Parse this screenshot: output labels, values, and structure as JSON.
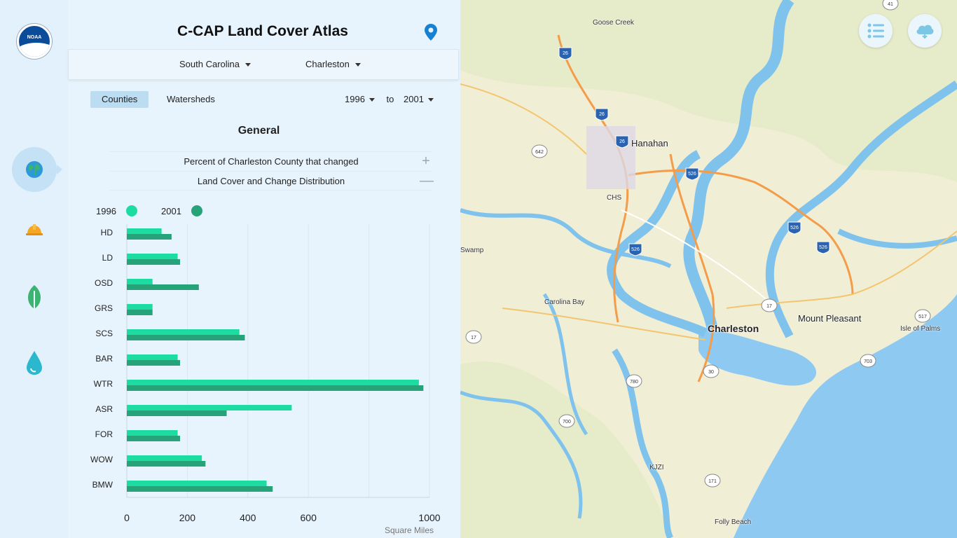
{
  "app": {
    "title": "C-CAP Land Cover Atlas",
    "logo_text": "NOAA"
  },
  "selectors": {
    "state": "South Carolina",
    "county": "Charleston"
  },
  "tabs": [
    {
      "label": "Counties",
      "active": true
    },
    {
      "label": "Watersheds",
      "active": false
    }
  ],
  "years": {
    "from": "1996",
    "to_label": "to",
    "to": "2001"
  },
  "section": {
    "title": "General"
  },
  "accordions": [
    {
      "label": "Percent of Charleston County that changed",
      "state": "+"
    },
    {
      "label": "Land Cover and Change Distribution",
      "state": "—"
    }
  ],
  "legend": [
    {
      "label": "1996",
      "color": "#1ddca2"
    },
    {
      "label": "2001",
      "color": "#27a37a"
    }
  ],
  "chart_data": {
    "type": "bar",
    "orientation": "horizontal",
    "categories": [
      "HD",
      "LD",
      "OSD",
      "GRS",
      "SCS",
      "BAR",
      "WTR",
      "ASR",
      "FOR",
      "WOW",
      "BMW"
    ],
    "series": [
      {
        "name": "1996",
        "color": "#1ddca2",
        "values": [
          115,
          168,
          85,
          85,
          372,
          168,
          965,
          545,
          168,
          248,
          462
        ]
      },
      {
        "name": "2001",
        "color": "#27a37a",
        "values": [
          148,
          176,
          238,
          85,
          390,
          176,
          980,
          330,
          176,
          260,
          482
        ]
      }
    ],
    "xlabel": "Square Miles",
    "xlim": [
      0,
      1000
    ],
    "xticks": [
      0,
      200,
      400,
      600,
      1000
    ],
    "grid": true
  },
  "sidebar_icons": [
    "globe-icon",
    "hard-hat-icon",
    "leaf-icon",
    "water-drop-icon"
  ],
  "map": {
    "buttons": [
      "list-icon",
      "cloud-icon"
    ],
    "labels": {
      "goose_creek": "Goose Creek",
      "hanahan": "Hanahan",
      "chs": "CHS",
      "swamp": "Swamp",
      "carolina_bay": "Carolina Bay",
      "charleston": "Charleston",
      "mount_pleasant": "Mount Pleasant",
      "isle_of_palms": "Isle of Palms",
      "kjzi": "KJZI",
      "folly_beach": "Folly Beach"
    },
    "shields": {
      "i26_a": "26",
      "i26_b": "26",
      "i26_c": "26",
      "i526_a": "526",
      "i526_b": "526",
      "i526_c": "526",
      "i526_d": "526",
      "i526_e": "526",
      "us17_a": "17",
      "us17_b": "17",
      "r41": "41",
      "r642": "642",
      "r30": "30",
      "r780": "780",
      "r700": "700",
      "r171": "171",
      "r703": "703",
      "r517": "517"
    }
  }
}
